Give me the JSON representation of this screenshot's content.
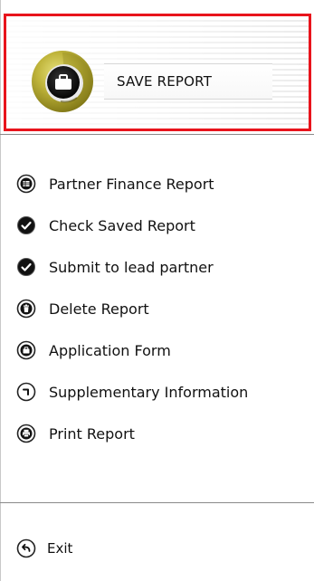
{
  "header": {
    "save_label": "SAVE REPORT",
    "border_color": "#e8141c",
    "icon": "briefcase-icon"
  },
  "menu": {
    "items": [
      {
        "label": "Partner Finance Report",
        "icon": "finance-icon"
      },
      {
        "label": "Check Saved Report",
        "icon": "check-icon"
      },
      {
        "label": "Submit to lead partner",
        "icon": "submit-check-icon"
      },
      {
        "label": "Delete Report",
        "icon": "trash-icon"
      },
      {
        "label": "Application Form",
        "icon": "folder-icon"
      },
      {
        "label": "Supplementary Information",
        "icon": "corner-arrow-icon"
      },
      {
        "label": "Print Report",
        "icon": "printer-icon"
      }
    ]
  },
  "footer": {
    "exit_label": "Exit",
    "icon": "back-arrow-icon"
  }
}
